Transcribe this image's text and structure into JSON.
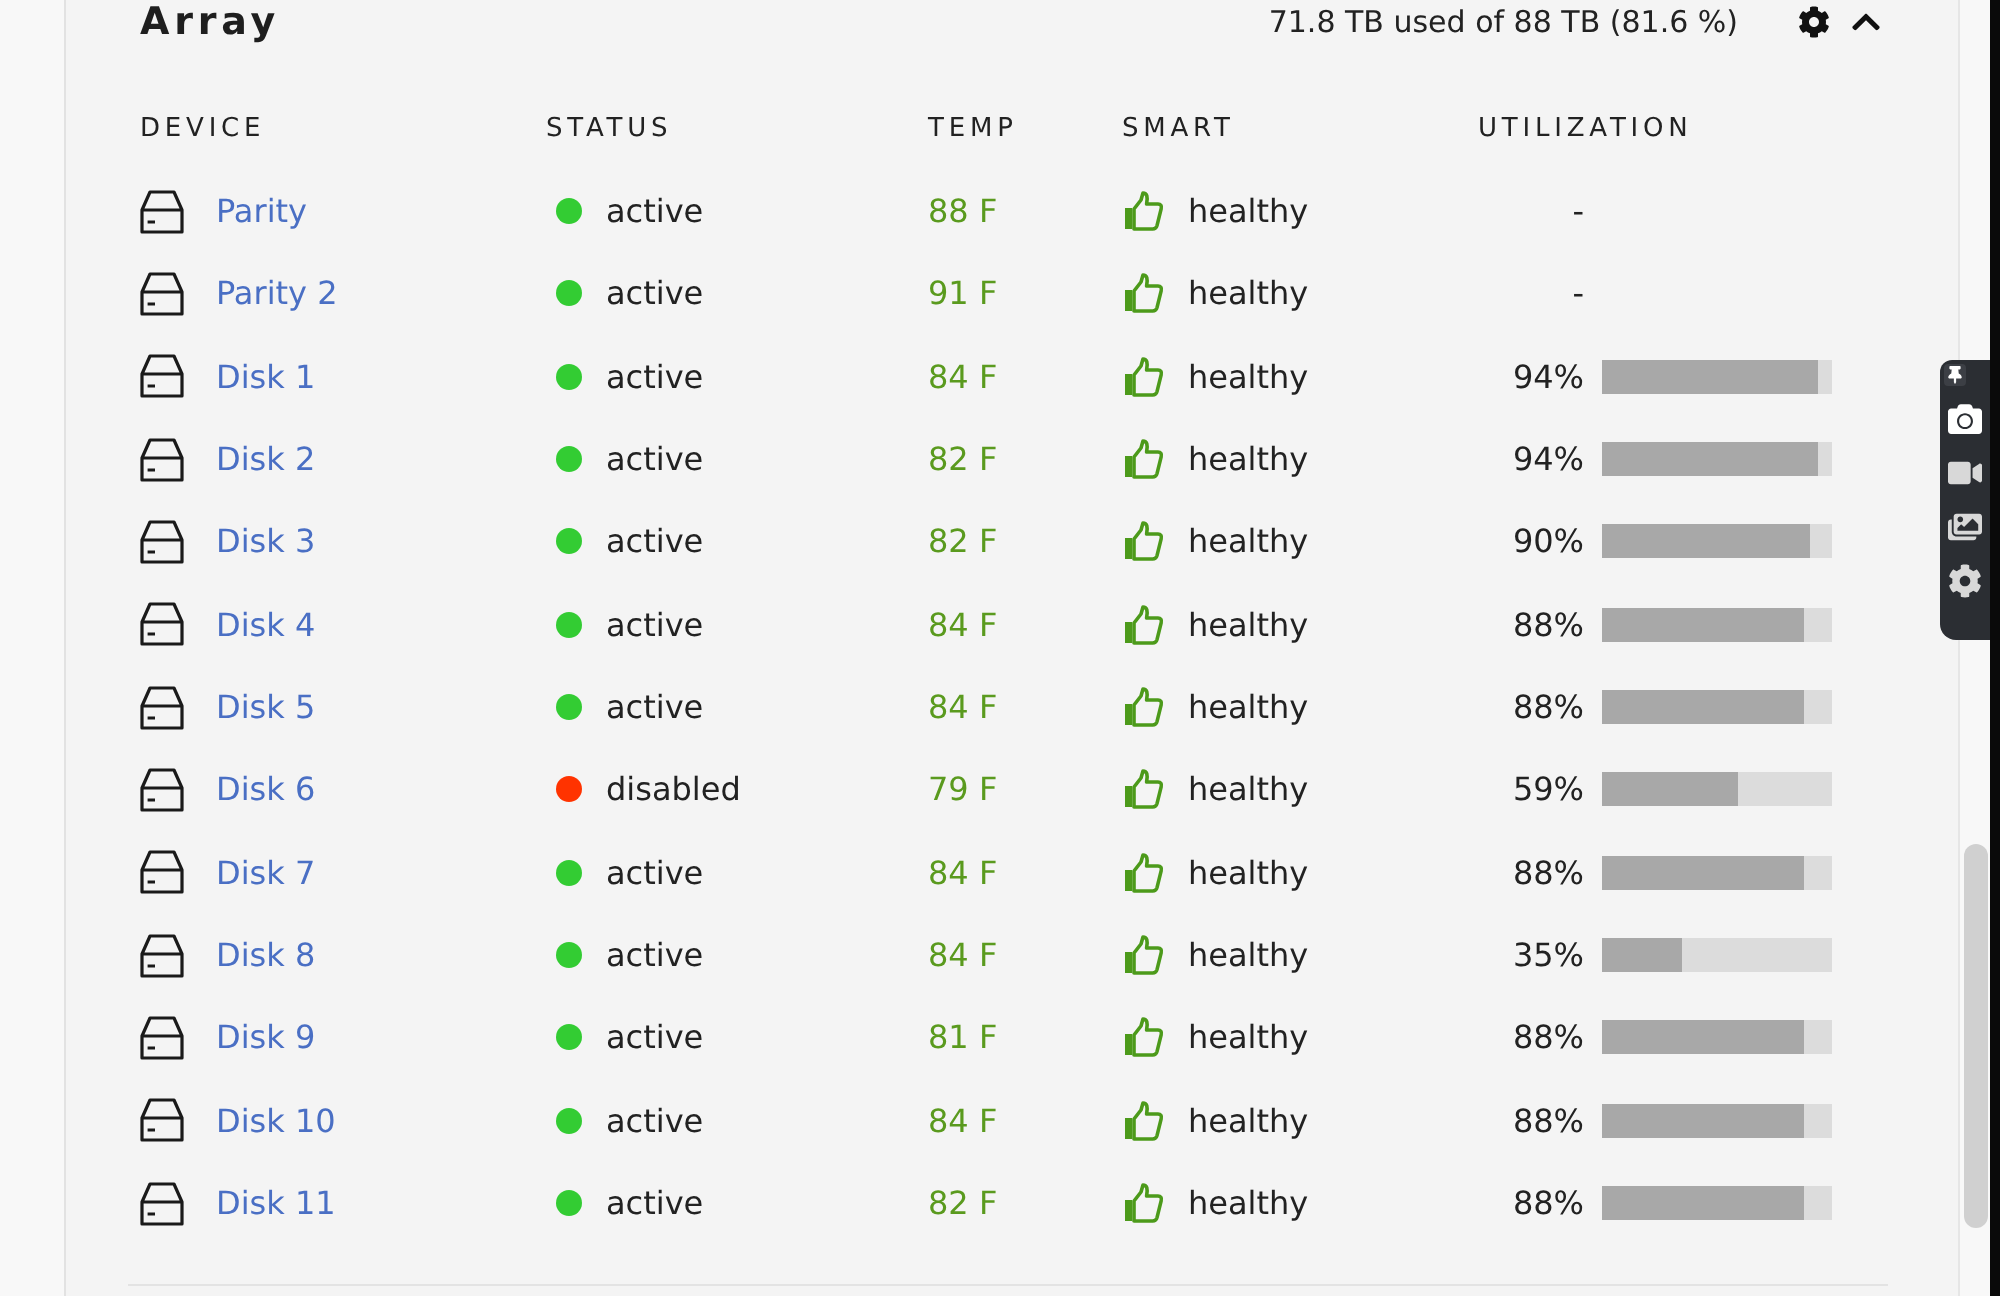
{
  "panel": {
    "title": "Array",
    "usage": "71.8 TB used of 88 TB (81.6 %)"
  },
  "table": {
    "columns": [
      "DEVICE",
      "STATUS",
      "TEMP",
      "SMART",
      "UTILIZATION"
    ],
    "rows": [
      {
        "device": "Parity",
        "status": {
          "label": "active",
          "color": "#33cc33"
        },
        "temp": "88 F",
        "smart": "healthy",
        "utilization": {
          "text": "-"
        }
      },
      {
        "device": "Parity 2",
        "status": {
          "label": "active",
          "color": "#33cc33"
        },
        "temp": "91 F",
        "smart": "healthy",
        "utilization": {
          "text": "-"
        }
      },
      {
        "device": "Disk 1",
        "status": {
          "label": "active",
          "color": "#33cc33"
        },
        "temp": "84 F",
        "smart": "healthy",
        "utilization": {
          "text": "94%",
          "level": 0.94
        }
      },
      {
        "device": "Disk 2",
        "status": {
          "label": "active",
          "color": "#33cc33"
        },
        "temp": "82 F",
        "smart": "healthy",
        "utilization": {
          "text": "94%",
          "level": 0.94
        }
      },
      {
        "device": "Disk 3",
        "status": {
          "label": "active",
          "color": "#33cc33"
        },
        "temp": "82 F",
        "smart": "healthy",
        "utilization": {
          "text": "90%",
          "level": 0.9
        }
      },
      {
        "device": "Disk 4",
        "status": {
          "label": "active",
          "color": "#33cc33"
        },
        "temp": "84 F",
        "smart": "healthy",
        "utilization": {
          "text": "88%",
          "level": 0.88
        }
      },
      {
        "device": "Disk 5",
        "status": {
          "label": "active",
          "color": "#33cc33"
        },
        "temp": "84 F",
        "smart": "healthy",
        "utilization": {
          "text": "88%",
          "level": 0.88
        }
      },
      {
        "device": "Disk 6",
        "status": {
          "label": "disabled",
          "color": "#ff3300"
        },
        "temp": "79 F",
        "smart": "healthy",
        "utilization": {
          "text": "59%",
          "level": 0.59
        }
      },
      {
        "device": "Disk 7",
        "status": {
          "label": "active",
          "color": "#33cc33"
        },
        "temp": "84 F",
        "smart": "healthy",
        "utilization": {
          "text": "88%",
          "level": 0.88
        }
      },
      {
        "device": "Disk 8",
        "status": {
          "label": "active",
          "color": "#33cc33"
        },
        "temp": "84 F",
        "smart": "healthy",
        "utilization": {
          "text": "35%",
          "level": 0.35
        }
      },
      {
        "device": "Disk 9",
        "status": {
          "label": "active",
          "color": "#33cc33"
        },
        "temp": "81 F",
        "smart": "healthy",
        "utilization": {
          "text": "88%",
          "level": 0.88
        }
      },
      {
        "device": "Disk 10",
        "status": {
          "label": "active",
          "color": "#33cc33"
        },
        "temp": "84 F",
        "smart": "healthy",
        "utilization": {
          "text": "88%",
          "level": 0.88
        }
      },
      {
        "device": "Disk 11",
        "status": {
          "label": "active",
          "color": "#33cc33"
        },
        "temp": "82 F",
        "smart": "healthy",
        "utilization": {
          "text": "88%",
          "level": 0.88
        }
      }
    ]
  }
}
